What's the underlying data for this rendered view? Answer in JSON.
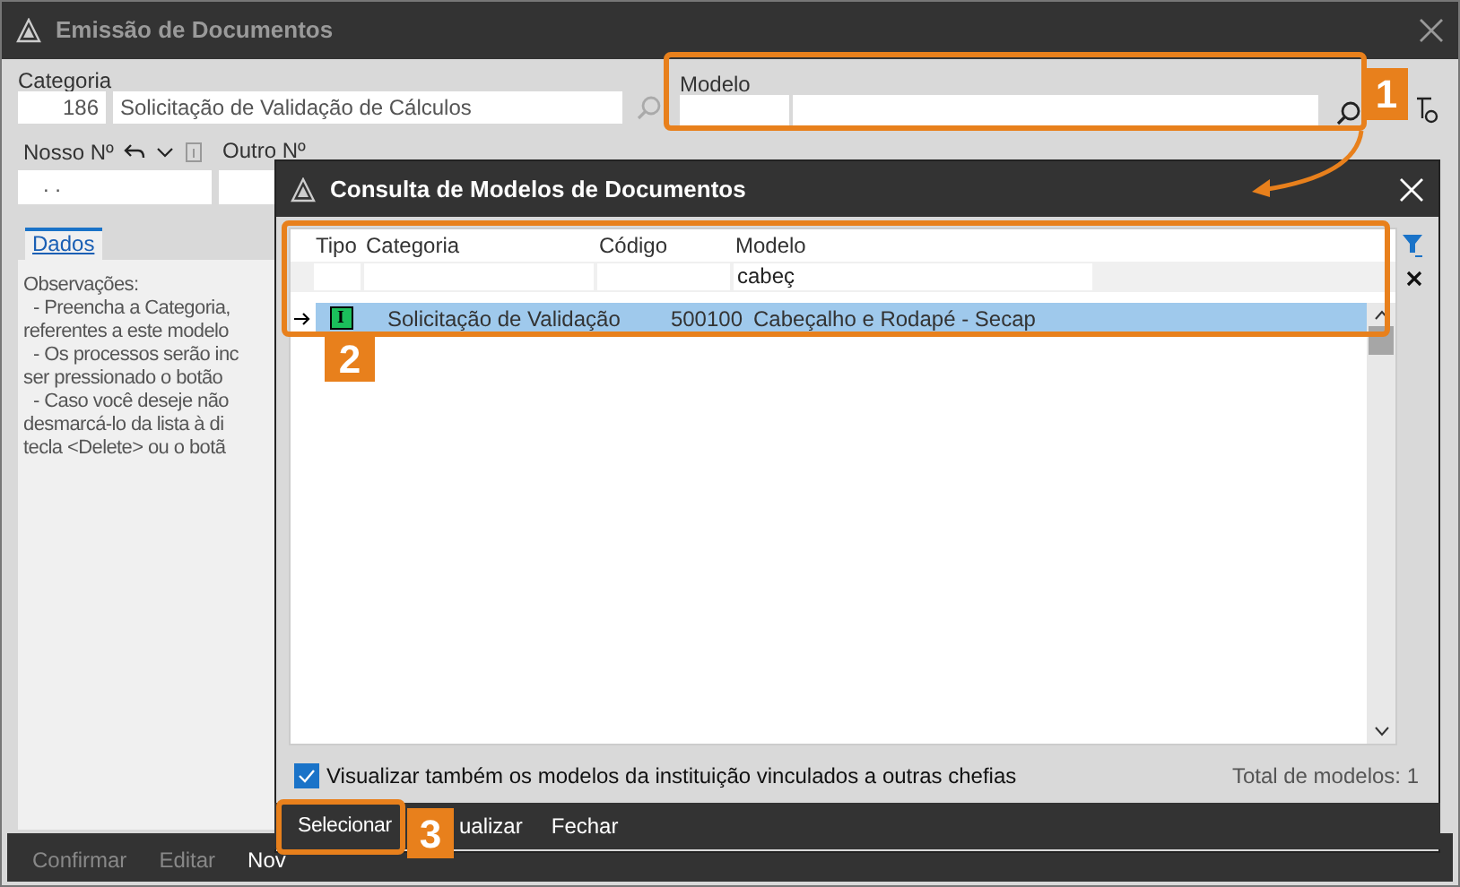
{
  "window": {
    "title": "Emissão de Documentos"
  },
  "categoria": {
    "label": "Categoria",
    "code": "186",
    "name": "Solicitação de Validação de Cálculos"
  },
  "modelo": {
    "label": "Modelo"
  },
  "nosso_no": {
    "label": "Nosso Nº",
    "value": ". ."
  },
  "outro_no": {
    "label": "Outro Nº"
  },
  "tabs": [
    {
      "label": "Dados",
      "selected": true
    }
  ],
  "observations": [
    "Observações:",
    "  - Preencha a Categoria,",
    "referentes a este modelo",
    "  - Os processos serão inc",
    "ser pressionado o botão",
    "  - Caso você deseje não",
    "desmarcá-lo da lista à di",
    "tecla <Delete> ou o botã"
  ],
  "actions": [
    {
      "label": "Confirmar",
      "disabled": true
    },
    {
      "label": "Editar",
      "disabled": true
    },
    {
      "label": "Nov",
      "disabled": false
    }
  ],
  "dialog": {
    "title": "Consulta de Modelos de Documentos",
    "columns": [
      "Tipo",
      "Categoria",
      "Código",
      "Modelo"
    ],
    "filter": {
      "modelo": "cabeç"
    },
    "rows": [
      {
        "tipo": "I",
        "categoria": "Solicitação de Validação",
        "codigo": "500100",
        "modelo": "Cabeçalho e Rodapé - Secap",
        "selected": true,
        "current": true
      }
    ],
    "checkbox": {
      "label": "Visualizar também os modelos da instituição vinculados a outras chefias",
      "checked": true
    },
    "total": "Total de modelos: 1",
    "buttons": [
      "Selecionar",
      "ualizar",
      "Fechar"
    ]
  },
  "annotations": [
    {
      "number": "1"
    },
    {
      "number": "2"
    },
    {
      "number": "3"
    }
  ]
}
